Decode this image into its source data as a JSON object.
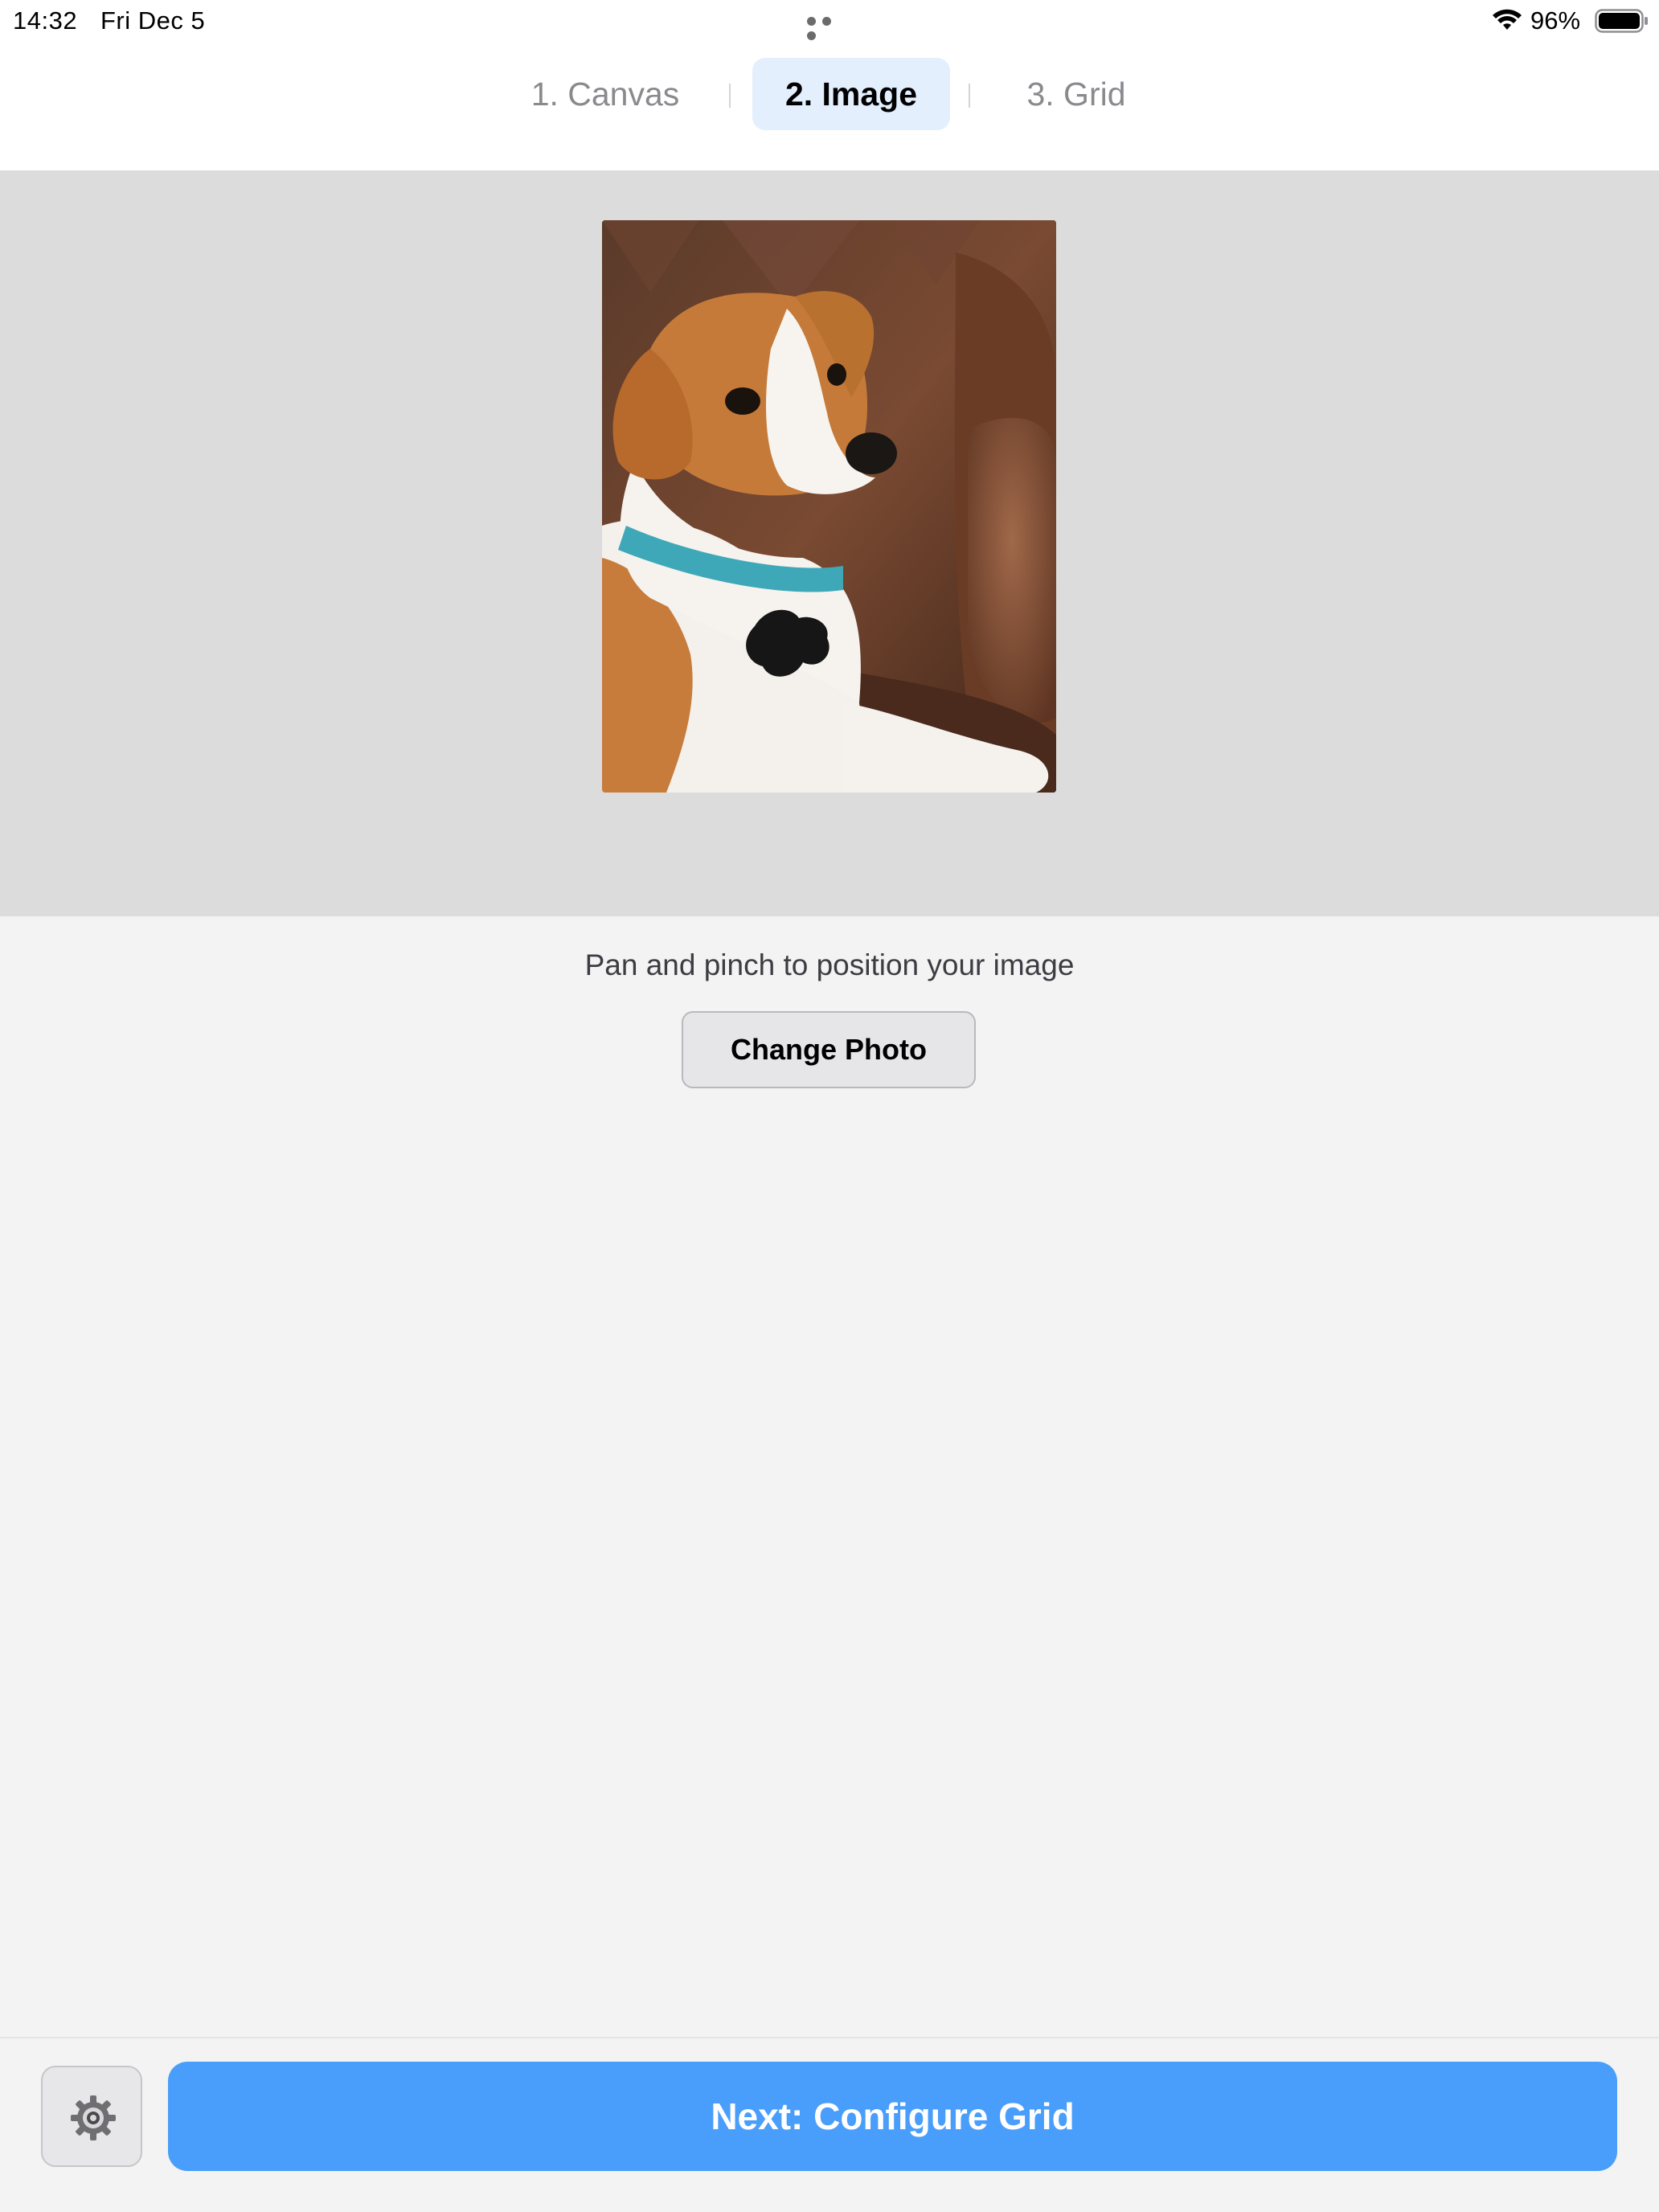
{
  "status_bar": {
    "time": "14:32",
    "date": "Fri Dec 5",
    "battery_percent": "96%",
    "battery_level": 0.96,
    "wifi_icon": "wifi-icon",
    "battery_icon": "battery-icon",
    "multitask_icon": "ellipsis-icon"
  },
  "tabs": [
    {
      "label": "1. Canvas",
      "active": false
    },
    {
      "label": "2. Image",
      "active": true
    },
    {
      "label": "3. Grid",
      "active": false
    }
  ],
  "preview": {
    "photo_icon": "dog-photo"
  },
  "controls": {
    "hint": "Pan and pinch to position your image",
    "change_photo_label": "Change Photo"
  },
  "bottom_bar": {
    "settings_icon": "gear-icon",
    "next_label": "Next: Configure Grid"
  },
  "colors": {
    "accent": "#4a9efb",
    "active_tab_bg": "#e4effd",
    "preview_bg": "#dcdcdc",
    "page_bg": "#f3f3f3"
  }
}
